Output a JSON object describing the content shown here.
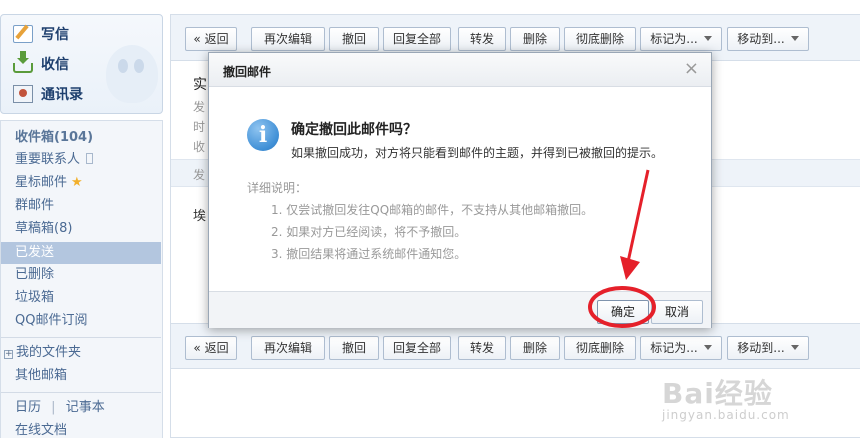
{
  "sidebar": {
    "quick": {
      "compose": "写信",
      "inbox": "收信",
      "contacts": "通讯录"
    },
    "folders": {
      "inbox": "收件箱(104)",
      "important": "重要联系人",
      "starred": "星标邮件",
      "group": "群邮件",
      "drafts": "草稿箱(8)",
      "sent": "已发送",
      "deleted": "已删除",
      "spam": "垃圾箱",
      "subscriptions": "QQ邮件订阅",
      "my_folders": "我的文件夹",
      "other_mailbox": "其他邮箱",
      "calendar": "日历",
      "divider": "|",
      "notes": "记事本",
      "docs": "在线文档"
    }
  },
  "toolbar": {
    "back": "« 返回",
    "edit_again": "再次编辑",
    "recall": "撤回",
    "reply_all": "回复全部",
    "forward": "转发",
    "delete": "删除",
    "delete_forever": "彻底删除",
    "mark_as": "标记为...",
    "move_to": "移动到..."
  },
  "mail": {
    "title_partial": "实",
    "from_label": "发",
    "time_label": "时",
    "to_label": "收",
    "sent_bar": "发",
    "body_partial": "埃"
  },
  "dialog": {
    "title": "撤回邮件",
    "close": "×",
    "icon_letter": "i",
    "question": "确定撤回此邮件吗？",
    "note": "如果撤回成功，对方将只能看到邮件的主题，并得到已被撤回的提示。",
    "details_label": "详细说明：",
    "details": [
      "1. 仅尝试撤回发往QQ邮箱的邮件，不支持从其他邮箱撤回。",
      "2. 如果对方已经阅读，将不予撤回。",
      "3. 撤回结果将通过系统邮件通知您。"
    ],
    "confirm": "确定",
    "cancel": "取消"
  },
  "watermark": {
    "brand": "Bai经验",
    "url": "jingyan.baidu.com"
  },
  "colors": {
    "annotation_red": "#e5202a",
    "active_folder": "#b3c6df",
    "toolbar_bg": "#eef3f9"
  }
}
